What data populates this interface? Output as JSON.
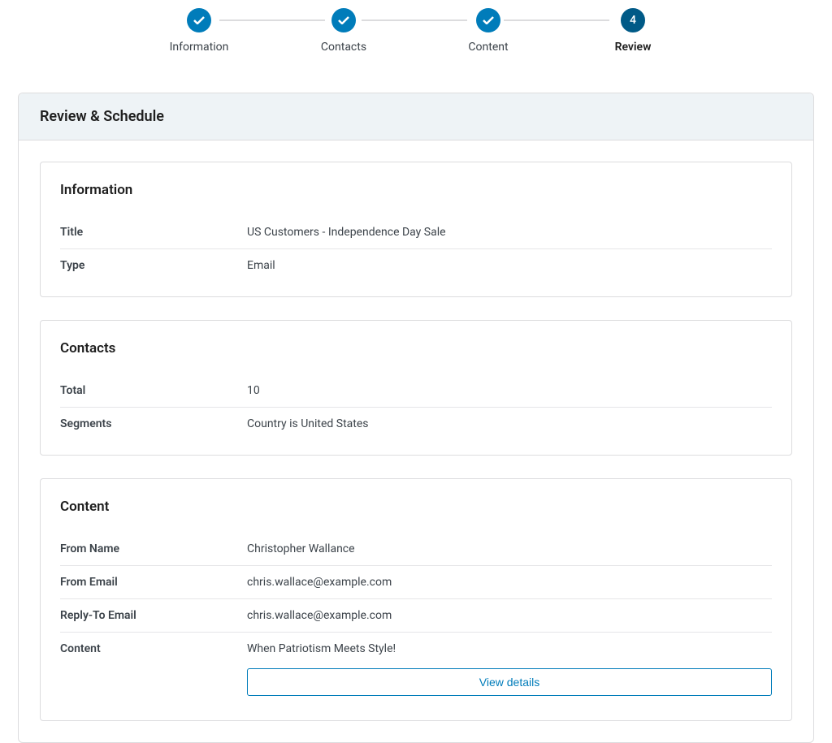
{
  "stepper": {
    "steps": [
      {
        "label": "Information",
        "state": "done"
      },
      {
        "label": "Contacts",
        "state": "done"
      },
      {
        "label": "Content",
        "state": "done"
      },
      {
        "label": "Review",
        "state": "current",
        "number": "4"
      }
    ]
  },
  "panel": {
    "title": "Review & Schedule"
  },
  "information": {
    "section_title": "Information",
    "rows": {
      "title_label": "Title",
      "title_value": "US Customers - Independence Day Sale",
      "type_label": "Type",
      "type_value": "Email"
    }
  },
  "contacts": {
    "section_title": "Contacts",
    "rows": {
      "total_label": "Total",
      "total_value": "10",
      "segments_label": "Segments",
      "segments_value": "Country is United States"
    }
  },
  "content": {
    "section_title": "Content",
    "rows": {
      "from_name_label": "From Name",
      "from_name_value": "Christopher Wallance",
      "from_email_label": "From Email",
      "from_email_value": "chris.wallace@example.com",
      "reply_to_label": "Reply-To Email",
      "reply_to_value": "chris.wallace@example.com",
      "content_label": "Content",
      "content_value": "When Patriotism Meets Style!",
      "view_details_label": "View details"
    }
  }
}
